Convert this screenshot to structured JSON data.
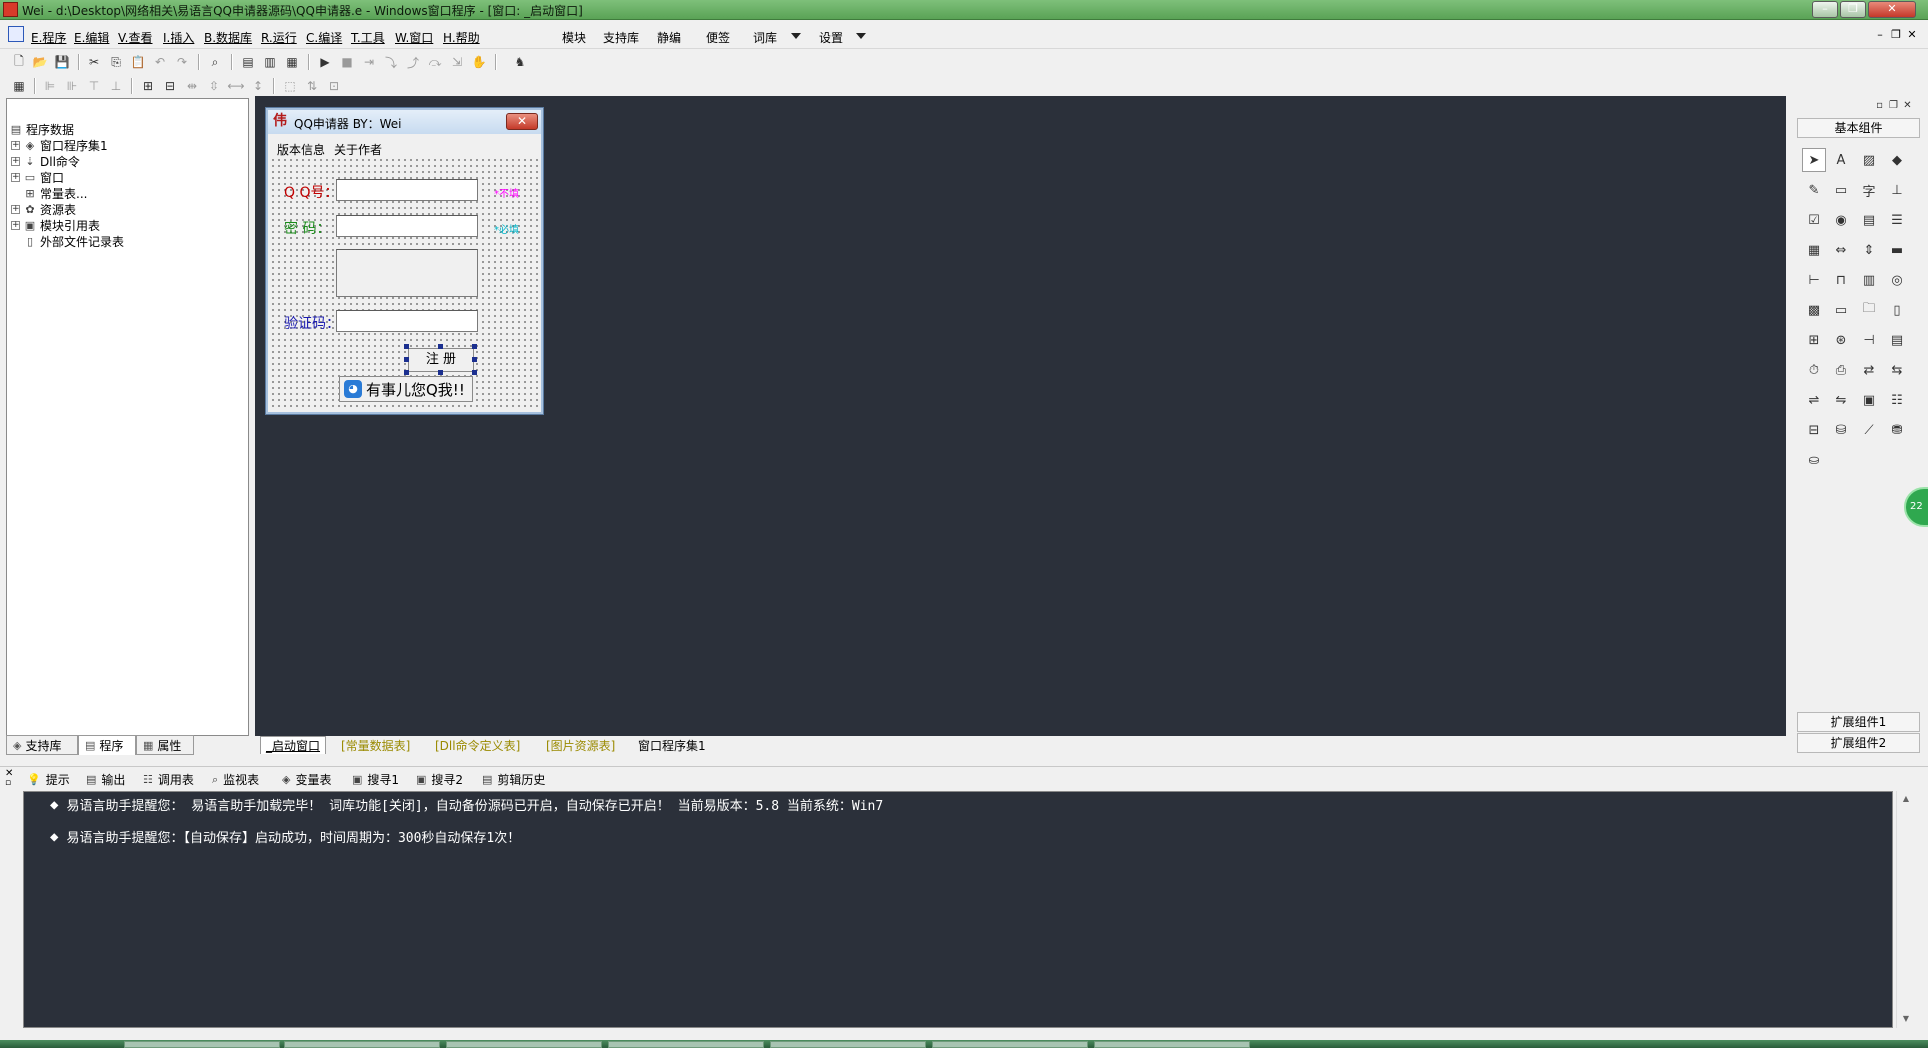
{
  "window": {
    "title": "Wei - d:\\Desktop\\网络相关\\易语言QQ申请器源码\\QQ申请器.e - Windows窗口程序 - [窗口: _启动窗口]",
    "minimize": "–",
    "restore": "❐",
    "close": "✕"
  },
  "menubar": {
    "items": [
      "E.程序",
      "E.编辑",
      "V.查看",
      "I.插入",
      "B.数据库",
      "R.运行",
      "C.编译",
      "T.工具",
      "W.窗口",
      "H.帮助"
    ],
    "extra": [
      "模块",
      "支持库",
      "静编",
      "便签",
      "词库",
      "设置"
    ],
    "mdi": [
      "–",
      "❐",
      "✕"
    ]
  },
  "toolbar_icons": {
    "row1": [
      "new-icon",
      "open-icon",
      "save-icon",
      "cut-icon",
      "copy-icon",
      "paste-icon",
      "undo-icon",
      "redo-icon",
      "find-icon",
      "layout1-icon",
      "layout2-icon",
      "layout3-icon",
      "run-icon",
      "stop-icon",
      "step-icon",
      "step-into-icon",
      "step-out-icon",
      "step-over-icon",
      "run-to-icon",
      "hand-icon",
      "chess-icon"
    ],
    "row2": [
      "grid-icon",
      "align-left-icon",
      "align-center-icon",
      "align-top-icon",
      "align-bottom-icon",
      "center-h-icon",
      "center-v-icon",
      "space-h-icon",
      "space-v-icon",
      "same-w-icon",
      "same-h-icon",
      "same-size-icon",
      "order-icon",
      "lock-icon",
      "fit-icon"
    ]
  },
  "left_panel": {
    "tree": [
      {
        "label": "程序数据",
        "icon": "program-data-icon",
        "expander": "",
        "indent": 0
      },
      {
        "label": "窗口程序集1",
        "icon": "assembly-icon",
        "expander": "+",
        "indent": 1
      },
      {
        "label": "Dll命令",
        "icon": "dll-icon",
        "expander": "+",
        "indent": 1
      },
      {
        "label": "窗口",
        "icon": "window-icon",
        "expander": "+",
        "indent": 1
      },
      {
        "label": "常量表...",
        "icon": "constant-icon",
        "expander": "",
        "indent": 1
      },
      {
        "label": "资源表",
        "icon": "resource-icon",
        "expander": "+",
        "indent": 1
      },
      {
        "label": "模块引用表",
        "icon": "module-icon",
        "expander": "+",
        "indent": 1
      },
      {
        "label": "外部文件记录表",
        "icon": "file-icon",
        "expander": "",
        "indent": 1
      }
    ],
    "tabs": [
      "支持库",
      "程序",
      "属性"
    ]
  },
  "design_window": {
    "title": "QQ申请器  BY：Wei",
    "menu": [
      "版本信息",
      "关于作者"
    ],
    "qq_label": "Q  Q号：",
    "pwd_label": "密  码：",
    "captcha_label": "验证码：",
    "qq_hint": "*不填",
    "pwd_hint": "*必填",
    "register_btn": "注 册",
    "contact_btn": "有事儿您Q我!!",
    "colors": {
      "qq_label": "#c00000",
      "pwd_label": "#1a8a1a",
      "captcha_label": "#1a1ab0",
      "qq_hint": "#ff00ff",
      "pwd_hint": "#00b4c8"
    }
  },
  "right_panel": {
    "header": "基本组件",
    "ext1": "扩展组件1",
    "ext2": "扩展组件2",
    "side_badge": "22"
  },
  "doc_tabs": [
    "_启动窗口",
    "[常量数据表]",
    "[Dll命令定义表]",
    "[图片资源表]",
    "窗口程序集1"
  ],
  "output_tabs": [
    {
      "label": "提示",
      "icon": "hint-icon"
    },
    {
      "label": "输出",
      "icon": "output-icon"
    },
    {
      "label": "调用表",
      "icon": "callstack-icon"
    },
    {
      "label": "监视表",
      "icon": "watch-icon"
    },
    {
      "label": "变量表",
      "icon": "variable-icon"
    },
    {
      "label": "搜寻1",
      "icon": "search1-icon"
    },
    {
      "label": "搜寻2",
      "icon": "search2-icon"
    },
    {
      "label": "剪辑历史",
      "icon": "clip-history-icon"
    }
  ],
  "output_lines": [
    "易语言助手提醒您：  易语言助手加载完毕！ 词库功能[关闭]，自动备份源码已开启，自动保存已开启！  当前易版本：5.8  当前系统：Win7",
    "易语言助手提醒您：【自动保存】启动成功，时间周期为：300秒自动保存1次！"
  ],
  "colors": {
    "work_bg": "#2b303a",
    "titlebar": "#6cb168"
  }
}
